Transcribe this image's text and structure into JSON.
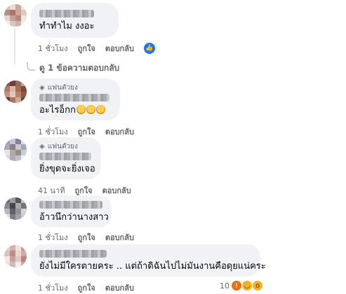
{
  "comments": [
    {
      "badge": "",
      "text": "ทำทำไม งงอะ",
      "time": "1 ชั่วโมง",
      "like_label": "ถูกใจ",
      "reply_label": "ตอบกลับ",
      "reaction_count": ""
    },
    {
      "badge": "แฟนตัวยง",
      "text": "อะไรอ็กก",
      "emoji_count": 3,
      "time": "1 ชั่วโมง",
      "like_label": "ถูกใจ",
      "reply_label": "ตอบกลับ"
    },
    {
      "badge": "แฟนตัวยง",
      "text": "ยิ่งขุดจะยิ่งเจอ",
      "time": "41 นาที",
      "like_label": "ถูกใจ",
      "reply_label": "ตอบกลับ"
    },
    {
      "badge": "",
      "text": "อ้าวนึกว่านางสาว",
      "time": "1 ชั่วโมง",
      "like_label": "ถูกใจ",
      "reply_label": "ตอบกลับ"
    },
    {
      "badge": "",
      "text": "ยังไม่มีใครตายคระ .. แต่ถ้าดิฉันไปไม่มันงานคือดุยแน่คระ",
      "time": "1 ชั่วโมง",
      "like_label": "ถูกใจ",
      "reply_label": "ตอบกลับ",
      "reaction_count": "10"
    }
  ],
  "replies_link": "ดู 1 ข้อความตอบกลับ",
  "icons": {
    "like": "thumbs-up-icon",
    "gem": "diamond-icon",
    "reactions": [
      "angry-icon",
      "haha-icon",
      "wow-icon"
    ]
  },
  "colors": {
    "bubble": "#f0f2f5",
    "meta": "#65676b",
    "like_blue": "#1877f2"
  }
}
